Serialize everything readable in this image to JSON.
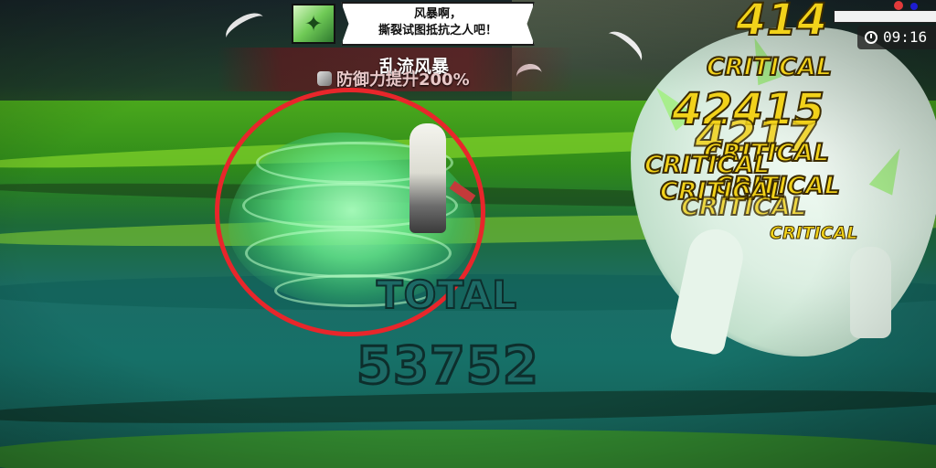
{
  "boss_dialog": {
    "portrait_icon": "boss-portrait-icon",
    "line1": "风暴啊，",
    "line2": "撕裂试图抵抗之人吧！"
  },
  "skill": {
    "name": "乱流风暴",
    "buff_icon": "buff-icon",
    "buff_text": "防御力提升200%"
  },
  "hud": {
    "timer": "09:16",
    "timer_icon": "clock-icon",
    "boss_hp_color": "#f2f2f2"
  },
  "damage_numbers": {
    "top": "414",
    "mid": "42415",
    "mid2": "4217"
  },
  "critical_label": "CRITICAL",
  "total": {
    "label": "TOTAL",
    "value": "53752"
  },
  "highlight": {
    "color": "#e8262b"
  }
}
